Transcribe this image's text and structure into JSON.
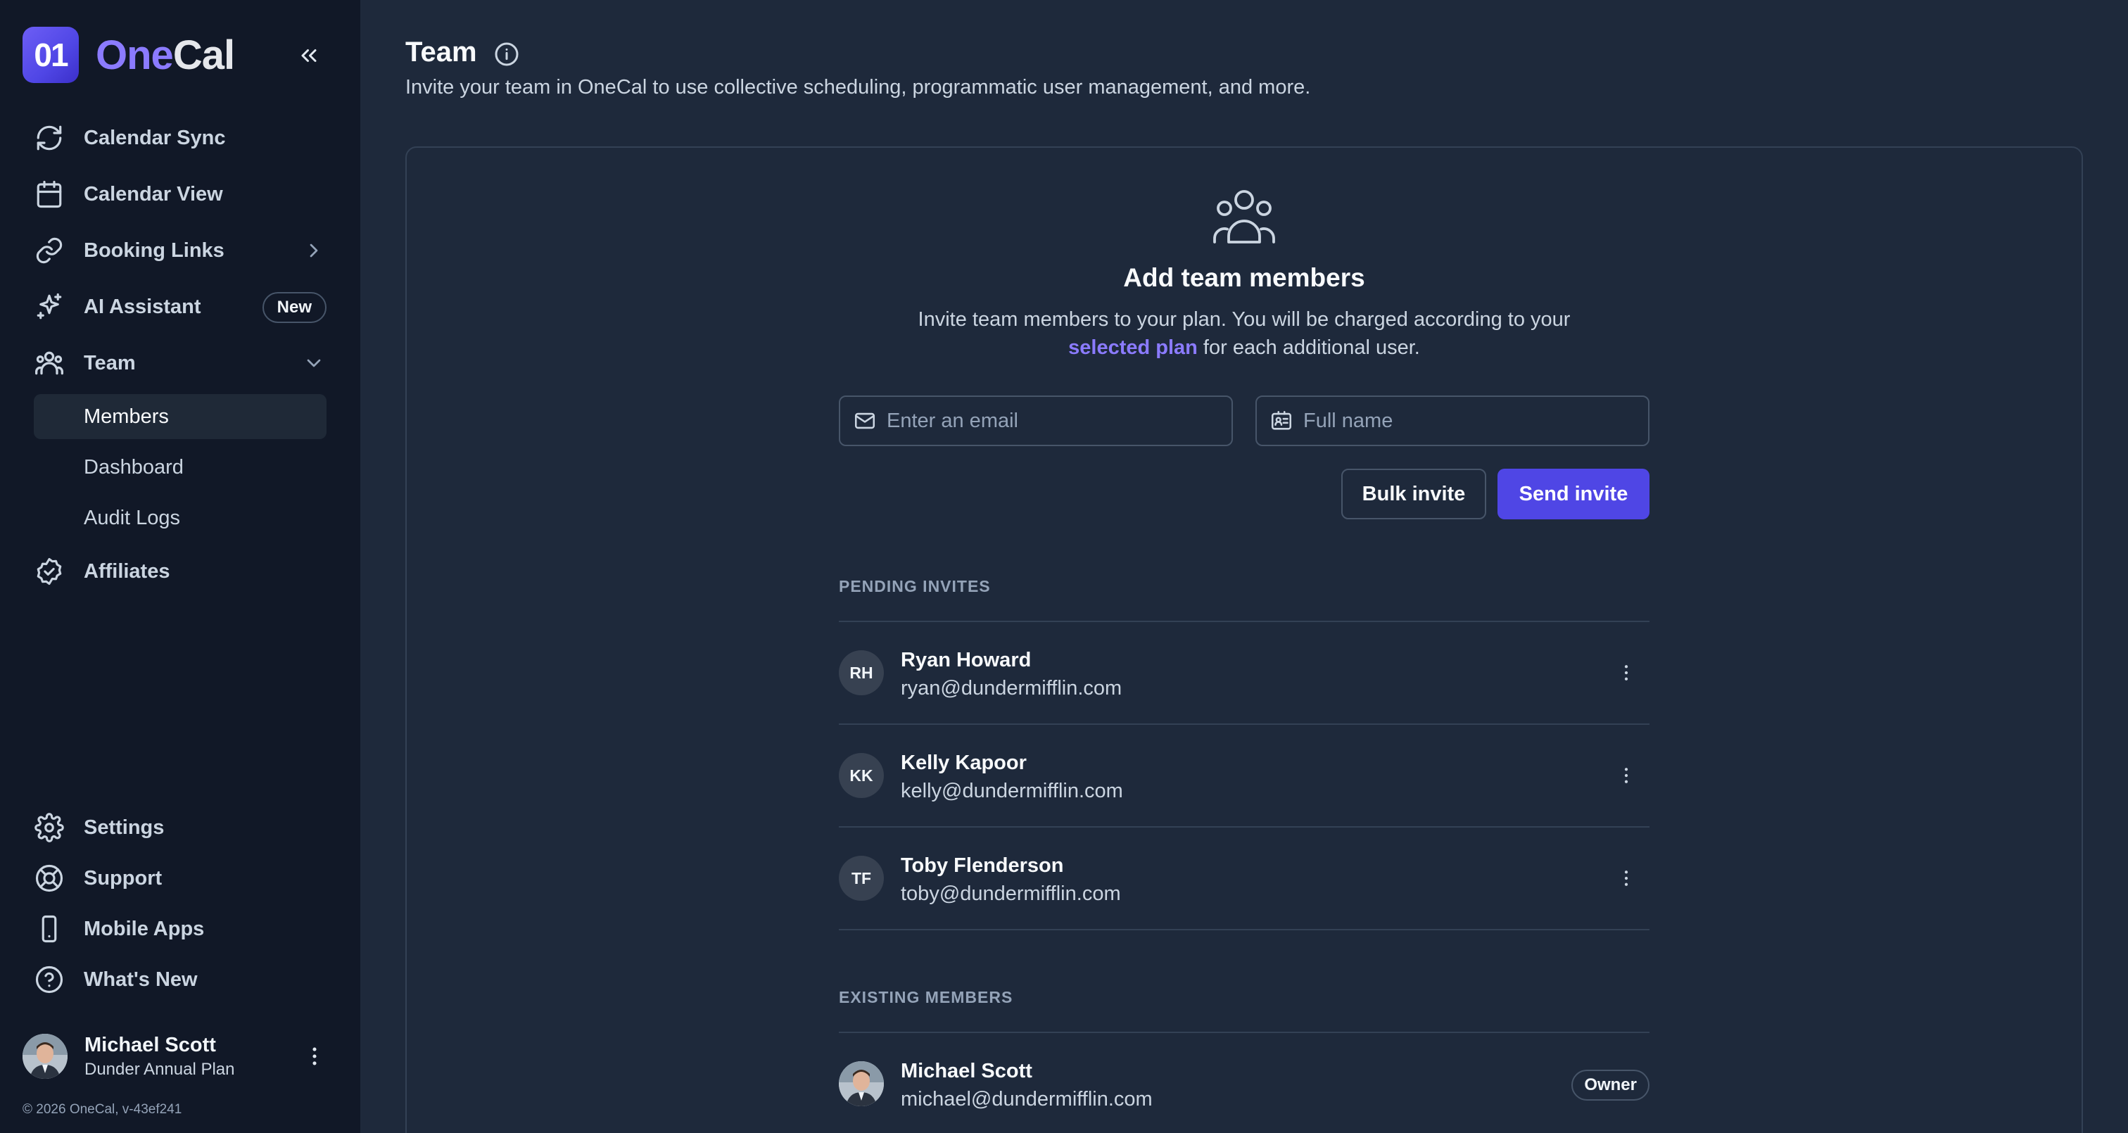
{
  "app": {
    "logo_mark": "01",
    "logo_text_one": "One",
    "logo_text_cal": "Cal"
  },
  "sidebar": {
    "items": [
      {
        "label": "Calendar Sync",
        "icon": "refresh-icon"
      },
      {
        "label": "Calendar View",
        "icon": "calendar-icon"
      },
      {
        "label": "Booking Links",
        "icon": "link-icon"
      },
      {
        "label": "AI Assistant",
        "icon": "sparkles-icon",
        "badge": "New"
      },
      {
        "label": "Team",
        "icon": "users-icon"
      },
      {
        "label": "Affiliates",
        "icon": "badge-check-icon"
      }
    ],
    "team_subitems": [
      {
        "label": "Members",
        "active": true
      },
      {
        "label": "Dashboard",
        "active": false
      },
      {
        "label": "Audit Logs",
        "active": false
      }
    ],
    "bottom_items": [
      {
        "label": "Settings",
        "icon": "gear-icon"
      },
      {
        "label": "Support",
        "icon": "lifebuoy-icon"
      },
      {
        "label": "Mobile Apps",
        "icon": "phone-icon"
      },
      {
        "label": "What's New",
        "icon": "help-circle-icon"
      }
    ],
    "user": {
      "name": "Michael Scott",
      "plan": "Dunder Annual Plan"
    },
    "copyright": "© 2026 OneCal, v-43ef241"
  },
  "page": {
    "title": "Team",
    "subtitle": "Invite your team in OneCal to use collective scheduling, programmatic user management, and more."
  },
  "invite": {
    "title": "Add team members",
    "desc_line1": "Invite team members to your plan. You will be charged according to your",
    "desc_link": "selected plan",
    "desc_line2_rest": " for each additional user.",
    "email_placeholder": "Enter an email",
    "name_placeholder": "Full name",
    "bulk_label": "Bulk invite",
    "send_label": "Send invite"
  },
  "pending": {
    "label": "PENDING INVITES",
    "rows": [
      {
        "initials": "RH",
        "name": "Ryan Howard",
        "email": "ryan@dundermifflin.com"
      },
      {
        "initials": "KK",
        "name": "Kelly Kapoor",
        "email": "kelly@dundermifflin.com"
      },
      {
        "initials": "TF",
        "name": "Toby Flenderson",
        "email": "toby@dundermifflin.com"
      }
    ]
  },
  "existing": {
    "label": "EXISTING MEMBERS",
    "rows": [
      {
        "name": "Michael Scott",
        "email": "michael@dundermifflin.com",
        "role": "Owner"
      }
    ]
  },
  "colors": {
    "accent": "#4f46e5",
    "link": "#8b7bff",
    "sidebar_bg": "#111827",
    "main_bg": "#1e293b"
  }
}
